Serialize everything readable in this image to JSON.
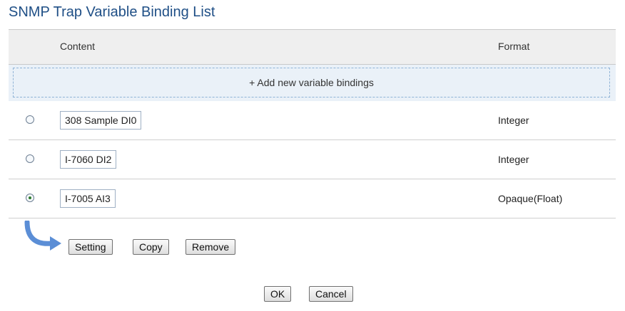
{
  "page": {
    "title": "SNMP Trap Variable Binding List"
  },
  "table": {
    "headers": {
      "content": "Content",
      "format": "Format"
    },
    "add_label": "+ Add new variable bindings",
    "rows": [
      {
        "content": "308 Sample DI0",
        "format": "Integer",
        "selected": false
      },
      {
        "content": "I-7060 DI2",
        "format": "Integer",
        "selected": false
      },
      {
        "content": "I-7005 AI3",
        "format": "Opaque(Float)",
        "selected": true
      }
    ]
  },
  "actions": {
    "setting": "Setting",
    "copy": "Copy",
    "remove": "Remove"
  },
  "footer": {
    "ok": "OK",
    "cancel": "Cancel"
  },
  "colors": {
    "title": "#1f4f86",
    "add_bg": "#eaf1f8",
    "arrow": "#5b8ed6"
  }
}
